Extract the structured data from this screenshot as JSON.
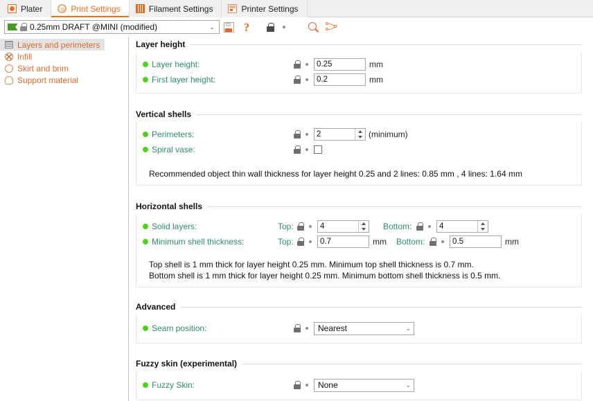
{
  "tabs": [
    {
      "label": "Plater",
      "icon": "plater-icon",
      "active": false
    },
    {
      "label": "Print Settings",
      "icon": "gear-icon",
      "active": true
    },
    {
      "label": "Filament Settings",
      "icon": "spool-icon",
      "active": false
    },
    {
      "label": "Printer Settings",
      "icon": "printer-icon",
      "active": false
    }
  ],
  "preset": {
    "value": "0.25mm DRAFT @MINI (modified)",
    "arrow": "⌄",
    "flag_icon": "green-flag-icon",
    "lock_icon": "lock-icon"
  },
  "toolbar": {
    "save_icon": "save-preset-icon",
    "help_icon": "question-mark-icon",
    "help_glyph": "?",
    "lock_icon": "lock-icon",
    "dot_icon": "revert-dot-icon",
    "search_icon": "search-icon",
    "compare_icon": "compare-presets-icon"
  },
  "sidebar": {
    "items": [
      {
        "label": "Layers and perimeters",
        "icon": "layers-icon",
        "selected": true
      },
      {
        "label": "Infill",
        "icon": "infill-icon",
        "selected": false
      },
      {
        "label": "Skirt and brim",
        "icon": "skirt-icon",
        "selected": false
      },
      {
        "label": "Support material",
        "icon": "support-icon",
        "selected": false
      }
    ]
  },
  "groups": {
    "layer_height": {
      "title": "Layer height",
      "rows": [
        {
          "label": "Layer height:",
          "value": "0.25",
          "unit": "mm"
        },
        {
          "label": "First layer height:",
          "value": "0.2",
          "unit": "mm"
        }
      ]
    },
    "vertical_shells": {
      "title": "Vertical shells",
      "perimeters": {
        "label": "Perimeters:",
        "value": "2",
        "suffix": "(minimum)"
      },
      "spiral_vase": {
        "label": "Spiral vase:",
        "checked": false
      },
      "note": "Recommended object thin wall thickness for layer height 0.25 and 2 lines: 0.85 mm , 4 lines: 1.64 mm"
    },
    "horizontal_shells": {
      "title": "Horizontal shells",
      "solid_layers": {
        "label": "Solid layers:",
        "top_label": "Top:",
        "top_value": "4",
        "bottom_label": "Bottom:",
        "bottom_value": "4"
      },
      "min_shell_thickness": {
        "label": "Minimum shell thickness:",
        "top_label": "Top:",
        "top_value": "0.7",
        "top_unit": "mm",
        "bottom_label": "Bottom:",
        "bottom_value": "0.5",
        "bottom_unit": "mm"
      },
      "note_line1": "Top shell is 1 mm thick for layer height 0.25 mm. Minimum top shell thickness is 0.7 mm.",
      "note_line2": "Bottom shell is 1 mm thick for layer height 0.25 mm. Minimum bottom shell thickness is 0.5 mm."
    },
    "advanced": {
      "title": "Advanced",
      "seam_position": {
        "label": "Seam position:",
        "value": "Nearest",
        "arrow": "⌄"
      }
    },
    "fuzzy_skin": {
      "title": "Fuzzy skin (experimental)",
      "fuzzy_skin": {
        "label": "Fuzzy Skin:",
        "value": "None",
        "arrow": "⌄"
      }
    }
  },
  "colors": {
    "accent_orange": "#ed6b21",
    "label_green": "#2e8b6e",
    "bullet_green": "#4fd11a",
    "tabbar_bg": "#f0f0f0",
    "selection_gray": "#e3e3e3"
  }
}
